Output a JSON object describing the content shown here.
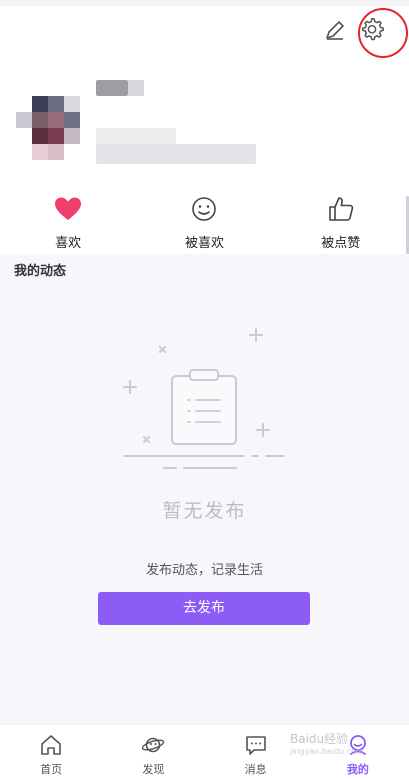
{
  "header": {
    "edit_icon": "pencil-icon",
    "settings_icon": "gear-icon",
    "highlight_color": "#e0252a"
  },
  "stats": [
    {
      "label": "喜欢",
      "icon": "heart-icon"
    },
    {
      "label": "被喜欢",
      "icon": "smiley-icon"
    },
    {
      "label": "被点赞",
      "icon": "thumbs-up-icon"
    }
  ],
  "feed": {
    "title": "我的动态",
    "empty_title": "暂无发布",
    "empty_subtitle": "发布动态，记录生活",
    "publish_label": "去发布"
  },
  "tabbar": {
    "items": [
      {
        "label": "首页",
        "icon": "home-icon"
      },
      {
        "label": "发现",
        "icon": "planet-icon"
      },
      {
        "label": "消息",
        "icon": "chat-icon"
      },
      {
        "label": "我的",
        "icon": "profile-icon",
        "active": true
      }
    ]
  },
  "watermark": {
    "text": "Baidu经验",
    "url": "jingyan.baidu.com"
  },
  "colors": {
    "accent": "#8b5cf6",
    "heart": "#ef3f6b",
    "feed_bg": "#f6f6fb"
  }
}
